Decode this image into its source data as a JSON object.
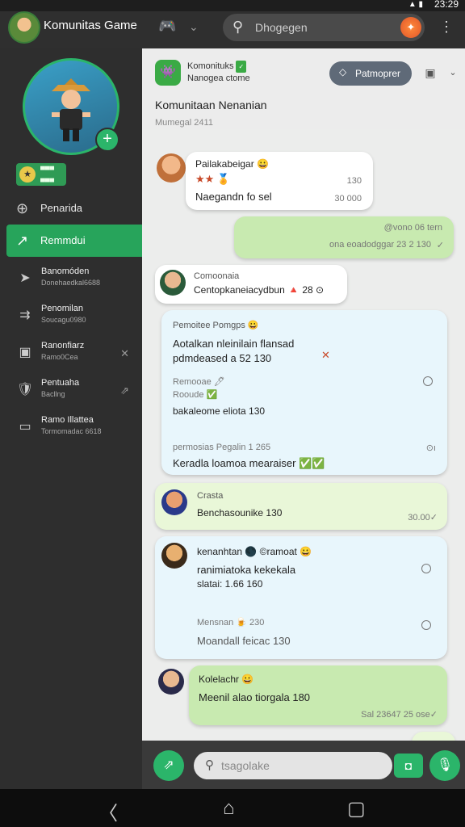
{
  "status": {
    "time": "23:29",
    "signal": "▲ ▮"
  },
  "header": {
    "title": "Komunitas Game",
    "back_icon": "gamepad-icon",
    "dropdown_icon": "chevron-down-icon",
    "search_placeholder": "Dhogegen",
    "badge_glyph": "✦"
  },
  "sidebar": {
    "badge_lines": [
      "▀▀▀",
      "▄▄▄"
    ],
    "nav": [
      {
        "label": "Penarida",
        "icon": "⊕"
      },
      {
        "label": "Remmdui",
        "icon": "↗"
      }
    ],
    "channels": [
      {
        "title": "Banomóden",
        "sub": "Donehaedkal6688",
        "icon": "➤",
        "close": ""
      },
      {
        "title": "Penomilan",
        "sub": "Soucagu0980",
        "icon": "⇉",
        "close": ""
      },
      {
        "title": "Ranonfiarz",
        "sub": "Ramo0Cea",
        "icon": "▣",
        "close": "✕"
      },
      {
        "title": "Pentuaha",
        "sub": "Bacllng",
        "icon": "🛡",
        "close": "⇗"
      },
      {
        "title": "Ramo Illattea",
        "sub": "Tormomadac 6618",
        "icon": "▭",
        "close": ""
      }
    ]
  },
  "group": {
    "name_line1": "Komonituks",
    "name_badge": "✓",
    "name_line2": "Nanogea ctome",
    "pill_label": "Patmoprer",
    "title": "Komunitaan Nenanian",
    "subtitle": "Mumegal 2411"
  },
  "messages": [
    {
      "name": "Pailakabeigar 😀",
      "line1": "★★ 🏅",
      "line2": "Naegandn fo sel",
      "time1": "130",
      "time2": "30 000"
    },
    {
      "line1": "@vono 06 tern",
      "line2": "ona eoadodggar 23 2 130",
      "check": "✓"
    },
    {
      "name": "Comoonaia",
      "line1": "Centopkaneiacydbun 🔺 28 ⊙"
    },
    {
      "name": "Pemoitee Pomgps 😀",
      "line1": "Aotalkan nleinilain flansad",
      "line2": "pdmdeased a 52 130",
      "star": "✕",
      "opt1": "Remooae 🖊",
      "opt2": "Rooude ✅",
      "opt3": "bakaleome eliota 130",
      "opt4": "permosias Pegalin 1 265",
      "opt5": "Keradla loamoa mearaiser ✅✅",
      "r2": "⊙ı"
    },
    {
      "name": "Crasta",
      "line1": "Benchasounike 130",
      "time": "30.00✓"
    },
    {
      "name": "kenanhtan 🌑 ©ramoat 😀",
      "line1": "ranimiatoka kekekala",
      "line2": "slatai: 1.66 160",
      "opt1": "Mensnan 🍺 230",
      "opt2": "Moandall feicac 130"
    },
    {
      "name": "Kolelachr 😀",
      "line1": "Meenil alao tiorgala 180",
      "time": "Sal 23647 25 ose✓"
    }
  ],
  "composer": {
    "placeholder": "tsagolake"
  },
  "navbar": {
    "back": "〈",
    "home": "⌂",
    "recent": "▢"
  }
}
